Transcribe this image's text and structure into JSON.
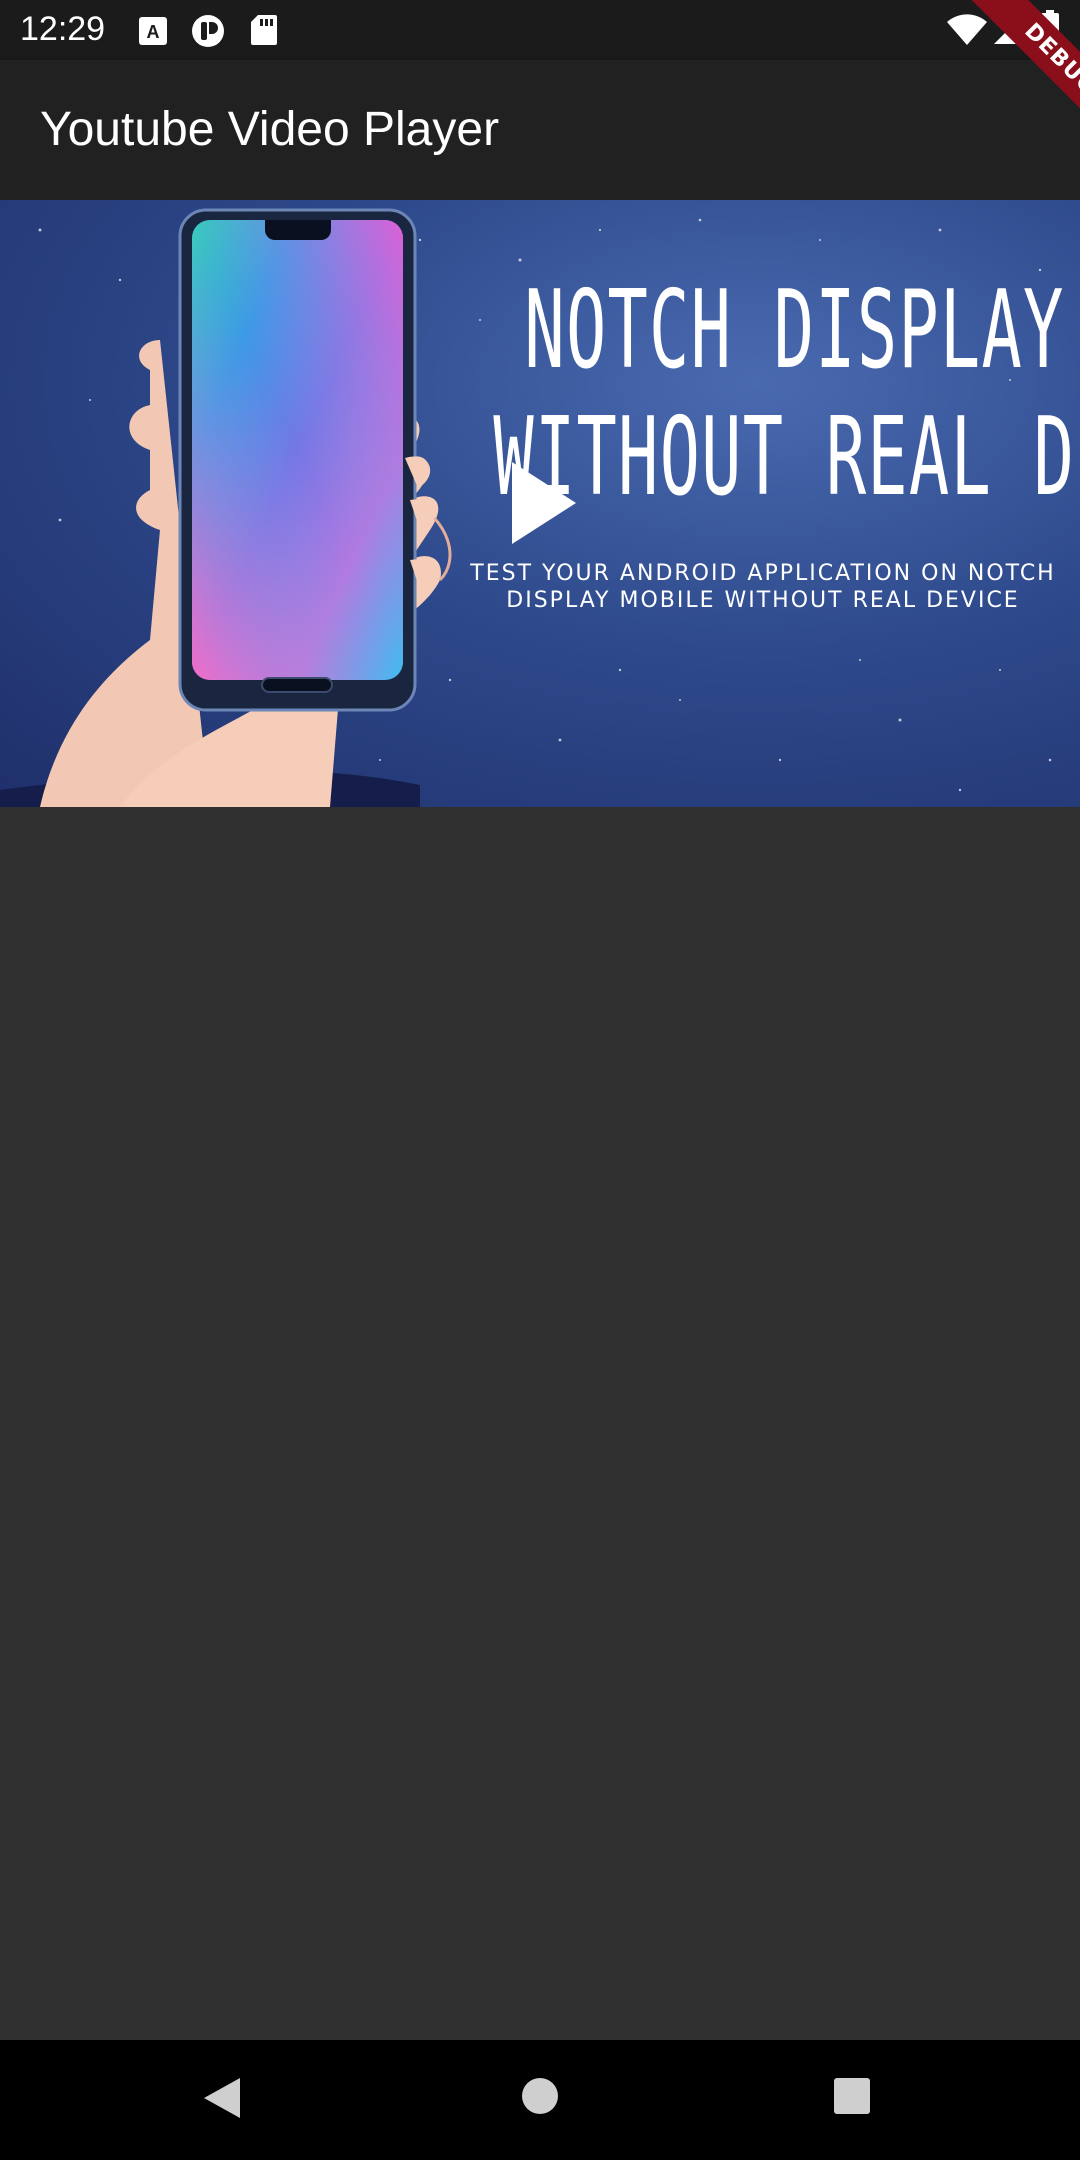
{
  "status_bar": {
    "time": "12:29",
    "left_icons": [
      "a-box-icon",
      "pocket-icon",
      "sd-card-icon"
    ],
    "right_icons": [
      "wifi-icon",
      "signal-icon",
      "battery-icon"
    ]
  },
  "debug_banner": {
    "label": "DEBUG"
  },
  "app_bar": {
    "title": "Youtube Video Player"
  },
  "video": {
    "thumbnail_line1": "NOTCH DISPLAY",
    "thumbnail_line2": "WITHOUT REAL DEVICE",
    "thumbnail_sub1": "TEST YOUR ANDROID APPLICATION ON NOTCH",
    "thumbnail_sub2": "DISPLAY MOBILE WITHOUT REAL DEVICE"
  },
  "nav_bar": {
    "buttons": [
      "back-icon",
      "home-icon",
      "recents-icon"
    ]
  },
  "colors": {
    "status_bar": "#1b1b1b",
    "app_bar": "#212121",
    "background": "#303030",
    "nav_bar": "#000000",
    "debug_ribbon": "#8b0f1a"
  }
}
